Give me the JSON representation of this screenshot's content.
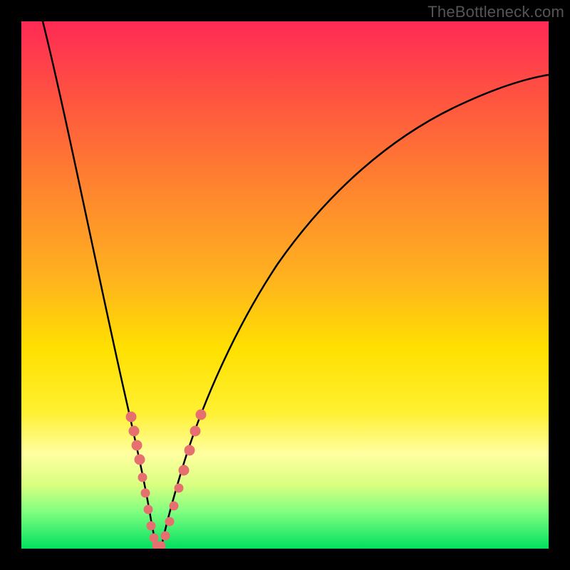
{
  "watermark": "TheBottleneck.com",
  "chart_data": {
    "type": "line",
    "title": "",
    "xlabel": "",
    "ylabel": "",
    "xlim": [
      0,
      100
    ],
    "ylim": [
      0,
      100
    ],
    "grid": false,
    "legend": false,
    "background_gradient": [
      "#ff2a55",
      "#ffe000",
      "#00e060"
    ],
    "series": [
      {
        "name": "curve-left",
        "x": [
          4,
          6,
          8,
          10,
          12,
          14,
          16,
          18,
          19,
          20,
          21,
          22,
          23,
          24,
          24.5
        ],
        "y": [
          100,
          88,
          76,
          64,
          52,
          41,
          31,
          22,
          18,
          14,
          11,
          8,
          5,
          2,
          0
        ]
      },
      {
        "name": "curve-right",
        "x": [
          26,
          27,
          28,
          29,
          30,
          32,
          34,
          37,
          41,
          46,
          52,
          60,
          70,
          82,
          96,
          100
        ],
        "y": [
          0,
          2,
          5,
          8,
          11,
          17,
          23,
          31,
          40,
          49,
          57,
          65,
          73,
          80,
          86,
          88
        ]
      },
      {
        "name": "dots",
        "x": [
          19.5,
          20.2,
          20.9,
          21.6,
          22.3,
          22.8,
          23.3,
          24.0,
          24.6,
          25.6,
          26.4,
          27.3,
          28.2,
          29.2,
          30.3,
          31.0
        ],
        "y": [
          24,
          21,
          18,
          15,
          12,
          9,
          6,
          3,
          1,
          1,
          3,
          6,
          10,
          15,
          20,
          24
        ],
        "color": "#e86a6a"
      }
    ]
  }
}
